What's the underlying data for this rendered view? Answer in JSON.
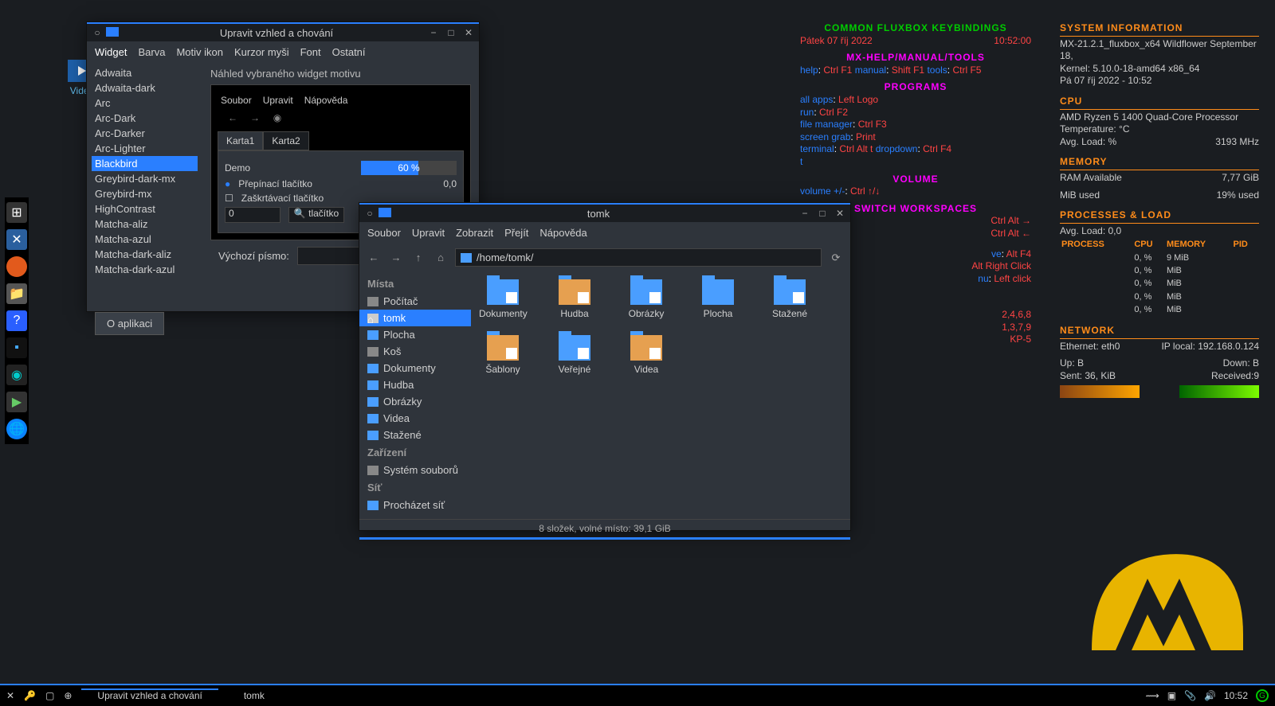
{
  "desktop": {
    "video_label": "Videa"
  },
  "appearance": {
    "title": "Upravit vzhled a chování",
    "tabs": [
      "Widget",
      "Barva",
      "Motiv ikon",
      "Kurzor myši",
      "Font",
      "Ostatní"
    ],
    "themes": [
      "Adwaita",
      "Adwaita-dark",
      "Arc",
      "Arc-Dark",
      "Arc-Darker",
      "Arc-Lighter",
      "Blackbird",
      "Greybird-dark-mx",
      "Greybird-mx",
      "HighContrast",
      "Matcha-aliz",
      "Matcha-azul",
      "Matcha-dark-aliz",
      "Matcha-dark-azul"
    ],
    "selected_theme": "Blackbird",
    "preview_header": "Náhled vybraného widget motivu",
    "preview": {
      "menu": [
        "Soubor",
        "Upravit",
        "Nápověda"
      ],
      "tabs": [
        "Karta1",
        "Karta2"
      ],
      "demo": "Demo",
      "toggle": "Přepínací tlačítko",
      "check": "Zaškrtávací tlačítko",
      "progress": "60 %",
      "coord": "0,0",
      "spin": "0",
      "search_btn": "tlačítko"
    },
    "default_font_label": "Výchozí písmo:",
    "about": "O aplikaci"
  },
  "fm": {
    "title": "tomk",
    "menu": [
      "Soubor",
      "Upravit",
      "Zobrazit",
      "Přejít",
      "Nápověda"
    ],
    "path": "/home/tomk/",
    "side": {
      "places_hdr": "Místa",
      "places": [
        "Počítač",
        "tomk",
        "Plocha",
        "Koš",
        "Dokumenty",
        "Hudba",
        "Obrázky",
        "Videa",
        "Stažené"
      ],
      "devices_hdr": "Zařízení",
      "devices": [
        "Systém souborů"
      ],
      "network_hdr": "Síť",
      "network": [
        "Procházet síť"
      ]
    },
    "folders": [
      "Dokumenty",
      "Hudba",
      "Obrázky",
      "Plocha",
      "Stažené",
      "Šablony",
      "Veřejné",
      "Videa"
    ],
    "status": "8 složek, volné místo: 39,1 GiB"
  },
  "conky_kb": {
    "title": "COMMON FLUXBOX KEYBINDINGS",
    "date": "Pátek 07 říj 2022",
    "time": "10:52:00",
    "sections": {
      "help_hdr": "MX-HELP/MANUAL/TOOLS",
      "help": [
        [
          "help",
          "Ctrl F1"
        ],
        [
          "manual",
          "Shift F1"
        ],
        [
          "tools",
          "Ctrl F5"
        ]
      ],
      "programs_hdr": "PROGRAMS",
      "programs": [
        [
          "all apps",
          "Left Logo"
        ],
        [
          "run",
          "Ctrl F2"
        ],
        [
          "file manager",
          "Ctrl F3"
        ],
        [
          "screen grab",
          "Print"
        ],
        [
          "terminal",
          "Ctrl Alt t"
        ],
        [
          "dropdown",
          "Ctrl F4"
        ],
        [
          "t",
          ""
        ]
      ],
      "volume_hdr": "VOLUME",
      "volume": [
        [
          "volume +/-",
          "Ctrl ↑/↓"
        ]
      ],
      "workspaces_hdr": "SWITCH WORKSPACES",
      "workspaces": [
        [
          "",
          "Ctrl Alt →"
        ],
        [
          "",
          "Ctrl Alt ←"
        ]
      ],
      "partial": [
        [
          "ve",
          "Alt F4"
        ],
        [
          "",
          "Alt Right Click"
        ],
        [
          "nu",
          "Left click"
        ],
        [
          "",
          "2,4,6,8"
        ],
        [
          "",
          "1,3,7,9"
        ],
        [
          "",
          "KP-5"
        ]
      ]
    }
  },
  "conky_sys": {
    "title": "SYSTEM INFORMATION",
    "lines": [
      "MX-21.2.1_fluxbox_x64 Wildflower September 18,",
      "Kernel: 5.10.0-18-amd64 x86_64",
      "Pá 07 říj 2022 - 10:52"
    ],
    "cpu_hdr": "CPU",
    "cpu_name": "AMD Ryzen 5 1400 Quad-Core Processor",
    "cpu_temp": "Temperature: °C",
    "cpu_load_l": "Avg. Load:   %",
    "cpu_load_r": "3193 MHz",
    "mem_hdr": "MEMORY",
    "ram_l": "RAM Available",
    "ram_r": "7,77 GiB",
    "ram_used_l": "    MiB used",
    "ram_used_r": "19% used",
    "proc_hdr": "PROCESSES & LOAD",
    "proc_avg": "Avg. Load: 0,0",
    "proc_cols": [
      "PROCESS",
      "CPU",
      "MEMORY",
      "PID"
    ],
    "proc_rows": [
      [
        "",
        "0,  %",
        "9   MiB",
        "    "
      ],
      [
        "",
        "0,  %",
        "    MiB",
        "    "
      ],
      [
        "",
        "0,  %",
        "    MiB",
        "    "
      ],
      [
        "",
        "0,  %",
        "    MiB",
        "    "
      ],
      [
        "",
        "0,  %",
        "    MiB",
        "    "
      ]
    ],
    "net_hdr": "NETWORK",
    "eth_l": "Ethernet: eth0",
    "eth_r": "IP local: 192.168.0.124",
    "up_l": "Up:      B",
    "down_l": "Down:      B",
    "sent": "Sent: 36,  KiB",
    "recv": "Received:9      "
  },
  "taskbar": {
    "tasks": [
      "Upravit vzhled a chování",
      "tomk"
    ],
    "clock": "10:52"
  }
}
